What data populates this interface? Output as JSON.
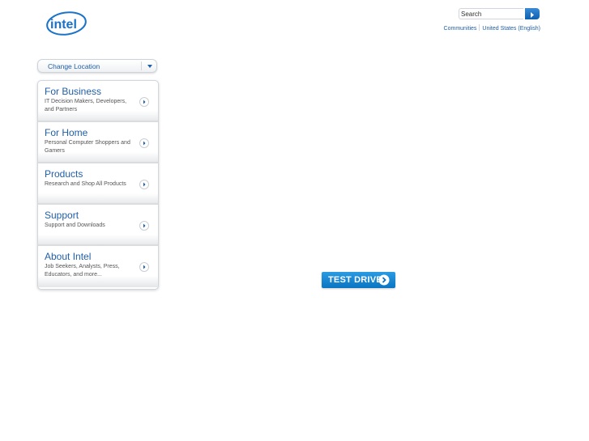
{
  "header": {
    "logo_text": "intel",
    "search": {
      "placeholder": "Search"
    },
    "links": [
      "Communities",
      "United States (English)"
    ]
  },
  "location": {
    "label": "Change Location"
  },
  "menu": {
    "items": [
      {
        "title": "For Business",
        "desc": "IT Decision Makers, Developers, and Partners"
      },
      {
        "title": "For Home",
        "desc": "Personal Computer Shoppers and Gamers"
      },
      {
        "title": "Products",
        "desc": "Research and Shop All Products"
      },
      {
        "title": "Support",
        "desc": "Support and Downloads"
      },
      {
        "title": "About Intel",
        "desc": "Job Seekers, Analysts, Press, Educators, and more..."
      }
    ]
  },
  "promo": {
    "button_label": "TEST DRIVE"
  },
  "colors": {
    "brand_blue": "#0071c5",
    "link_blue": "#1f5fa8"
  },
  "icons": [
    "intel-logo",
    "search-arrow-icon",
    "chevron-down-icon",
    "chevron-right-icon"
  ]
}
